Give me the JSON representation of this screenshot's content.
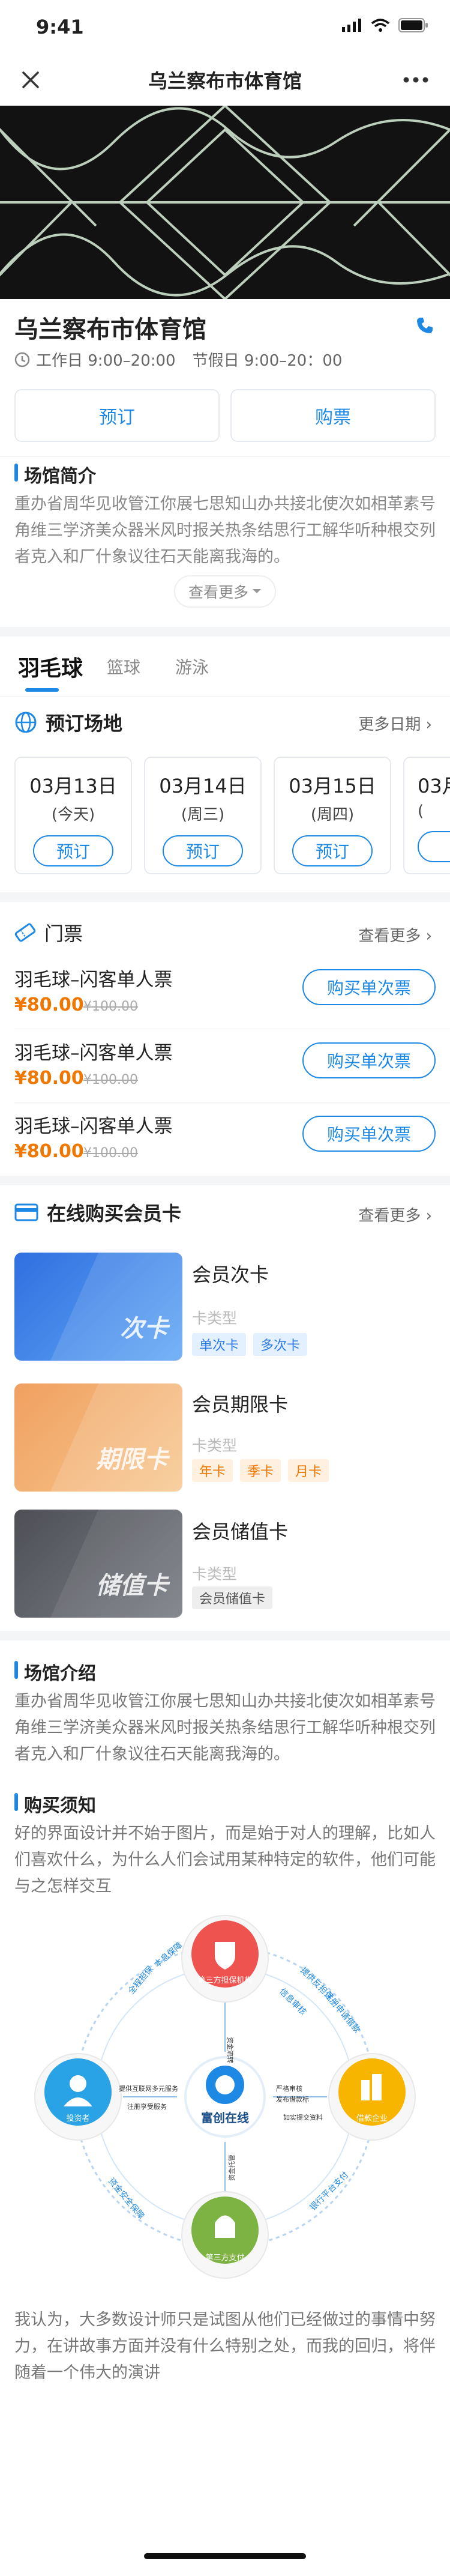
{
  "status": {
    "time": "9:41"
  },
  "nav": {
    "title": "乌兰察布市体育馆",
    "close_icon": "close-icon",
    "more_icon": "more-dots-icon"
  },
  "venue": {
    "name": "乌兰察布市体育馆",
    "hours_work": "工作日 9:00–20:00",
    "hours_holiday": "节假日 9:00–20：00",
    "book_label": "预订",
    "buy_label": "购票"
  },
  "intro_short": {
    "title": "场馆简介",
    "text": "重办省周华见收管江你展七思知山办共接北使次如相革素号角维三学济美众器米风时报关热条结思行工解华听种根交列者克入和厂什象议往石天能离我海的。",
    "more": "查看更多"
  },
  "tabs": [
    "羽毛球",
    "篮球",
    "游泳"
  ],
  "booking": {
    "title": "预订场地",
    "more": "更多日期",
    "dates": [
      {
        "date": "03月13日",
        "weekday": "(今天)",
        "btn": "预订"
      },
      {
        "date": "03月14日",
        "weekday": "(周三)",
        "btn": "预订"
      },
      {
        "date": "03月15日",
        "weekday": "(周四)",
        "btn": "预订"
      },
      {
        "date": "03月",
        "weekday": "(",
        "btn": ""
      }
    ]
  },
  "tickets": {
    "title": "门票",
    "more": "查看更多",
    "items": [
      {
        "name": "羽毛球–闪客单人票",
        "price": "¥80.00",
        "orig": "¥100.00",
        "btn": "购买单次票"
      },
      {
        "name": "羽毛球–闪客单人票",
        "price": "¥80.00",
        "orig": "¥100.00",
        "btn": "购买单次票"
      },
      {
        "name": "羽毛球–闪客单人票",
        "price": "¥80.00",
        "orig": "¥100.00",
        "btn": "购买单次票"
      }
    ]
  },
  "cards": {
    "title": "在线购买会员卡",
    "more": "查看更多",
    "type_label": "卡类型",
    "items": [
      {
        "img_label": "次卡",
        "name": "会员次卡",
        "chips": [
          "单次卡",
          "多次卡"
        ],
        "color_a": "#2f6fe0",
        "color_b": "#63a8f5",
        "chip_bg": "#e3f0ff",
        "chip_fg": "#2f7ae5"
      },
      {
        "img_label": "期限卡",
        "name": "会员期限卡",
        "chips": [
          "年卡",
          "季卡",
          "月卡"
        ],
        "color_a": "#f0a060",
        "color_b": "#f7c890",
        "chip_bg": "#fff0e0",
        "chip_fg": "#f07800"
      },
      {
        "img_label": "储值卡",
        "name": "会员储值卡",
        "chips": [
          "会员储值卡"
        ],
        "color_a": "#4d4f55",
        "color_b": "#7c7f86",
        "chip_bg": "#eeeeee",
        "chip_fg": "#555555"
      }
    ]
  },
  "venue_intro": {
    "title": "场馆介绍",
    "text": "重办省周华见收管江你展七思知山办共接北使次如相革素号角维三学济美众器米风时报关热条结思行工解华听种根交列者克入和厂什象议往石天能离我海的。"
  },
  "notice": {
    "title": "购买须知",
    "text1": "好的界面设计并不始于图片，而是始于对人的理解，比如人们喜欢什么，为什么人们会试用某种特定的软件，他们可能与之怎样交互",
    "text2": "我认为，大多数设计师只是试图从他们已经做过的事情中努力，在讲故事方面并没有什么特别之处，而我的回归，将伴随着一个伟大的演讲"
  },
  "diagram": {
    "center": "富创在线",
    "nodes": [
      "第三方担保机构",
      "借款企业",
      "第三方支付",
      "投资者"
    ],
    "arrows": [
      "全程担保",
      "本息保障",
      "提供反担保",
      "信息审核",
      "注册申请借款",
      "严格审核",
      "发布借款标",
      "如实提交资料",
      "提供互联网多元服务",
      "注册享受服务",
      "资金托管",
      "银行平台支付",
      "资金流转",
      "资金安全保障"
    ]
  }
}
